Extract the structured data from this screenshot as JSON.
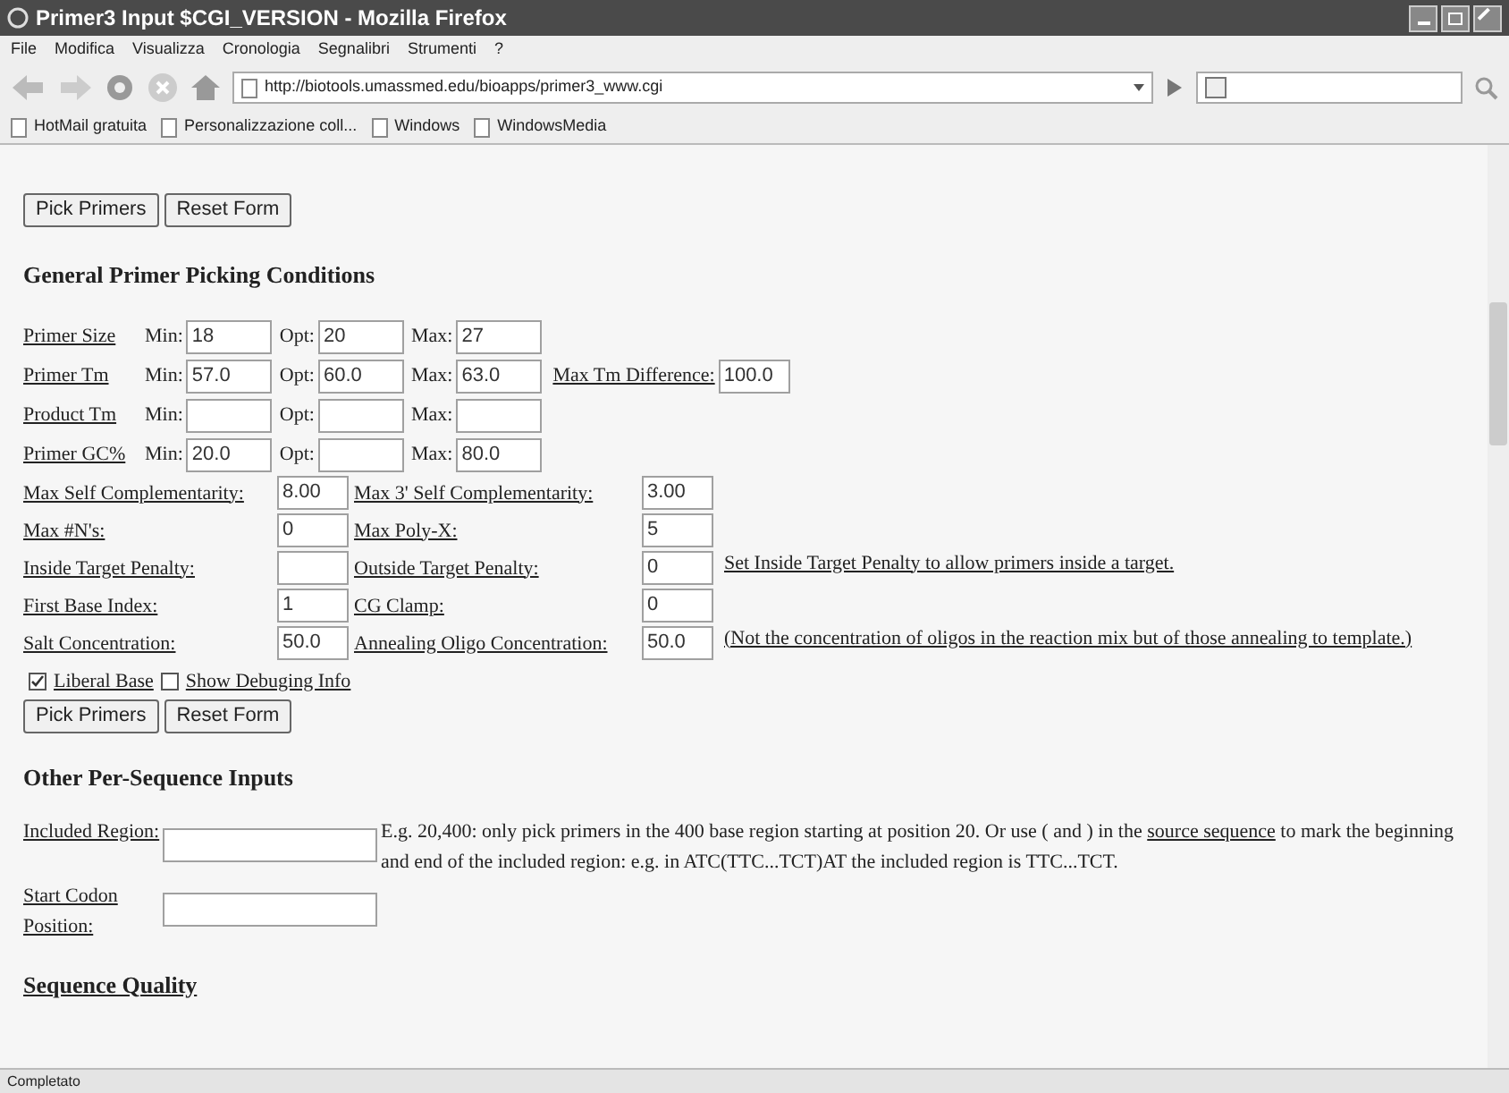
{
  "window": {
    "title": "Primer3 Input $CGI_VERSION - Mozilla Firefox"
  },
  "menu": [
    "File",
    "Modifica",
    "Visualizza",
    "Cronologia",
    "Segnalibri",
    "Strumenti",
    "?"
  ],
  "address": {
    "value": "http://biotools.umassmed.edu/bioapps/primer3_www.cgi"
  },
  "bookmarks": [
    "HotMail gratuita",
    "Personalizzazione coll...",
    "Windows",
    "WindowsMedia"
  ],
  "top_buttons": [
    "Pick Primers",
    "Reset Form"
  ],
  "heading_general": "General Primer Picking Conditions",
  "range_rows": [
    {
      "label": "Primer Size",
      "fields": [
        {
          "label": "Min:",
          "value": "18"
        },
        {
          "label": "Opt:",
          "value": "20"
        },
        {
          "label": "Max:",
          "value": "27"
        }
      ]
    },
    {
      "label": "Primer Tm",
      "fields": [
        {
          "label": "Min:",
          "value": "57.0"
        },
        {
          "label": "Opt:",
          "value": "60.0"
        },
        {
          "label": "Max:",
          "value": "63.0"
        }
      ],
      "extra": {
        "label": "Max Tm Difference:",
        "value": "100.0"
      }
    },
    {
      "label": "Product Tm",
      "fields": [
        {
          "label": "Min:"
        },
        {
          "label": "Opt:"
        },
        {
          "label": "Max:"
        }
      ]
    },
    {
      "label": "Primer GC%",
      "fields": [
        {
          "label": "Min:",
          "value": "20.0"
        },
        {
          "label": "Opt:"
        },
        {
          "label": "Max:",
          "value": "80.0"
        }
      ]
    }
  ],
  "pair_rows": [
    {
      "label": "Max Self Complementarity:",
      "value": "8.00",
      "label2": "Max 3' Self Complementarity:",
      "value2": "3.00"
    },
    {
      "label": "Max #N's:",
      "value": "0",
      "label2": "Max Poly-X:",
      "value2": "5"
    },
    {
      "label": "Inside Target Penalty:",
      "value": "",
      "label2": "Outside Target Penalty:",
      "value2": "0",
      "note": "Set Inside Target Penalty to allow primers inside a target."
    },
    {
      "label": "First Base Index:",
      "value": "1",
      "label2": "CG Clamp:",
      "value2": "0"
    },
    {
      "label": "Salt Concentration:",
      "value": "50.0",
      "label2": "Annealing Oligo Concentration:",
      "value2": "50.0",
      "note": "(Not the concentration of oligos in the reaction mix but of those annealing to template.)"
    }
  ],
  "checkboxes": [
    {
      "label": "Liberal Base",
      "checked": true
    },
    {
      "label": "Show Debuging Info",
      "checked": false
    }
  ],
  "buttons": [
    "Pick Primers",
    "Reset Form"
  ],
  "heading_other": "Other Per-Sequence Inputs",
  "sequence_inputs": [
    {
      "label": "Included Region:",
      "note_before": "E.g. 20,400: only pick primers in the 400 base region starting at position 20. Or use ( and ) in the",
      "note_link": "source sequence",
      "note_after": "to mark the beginning and end of the included region: e.g. in ATC(TTC...TCT)AT the included region is TTC...TCT."
    },
    {
      "label": "Start Codon Position:"
    }
  ],
  "heading_quality": "Sequence Quality",
  "status_bar": "Completato"
}
